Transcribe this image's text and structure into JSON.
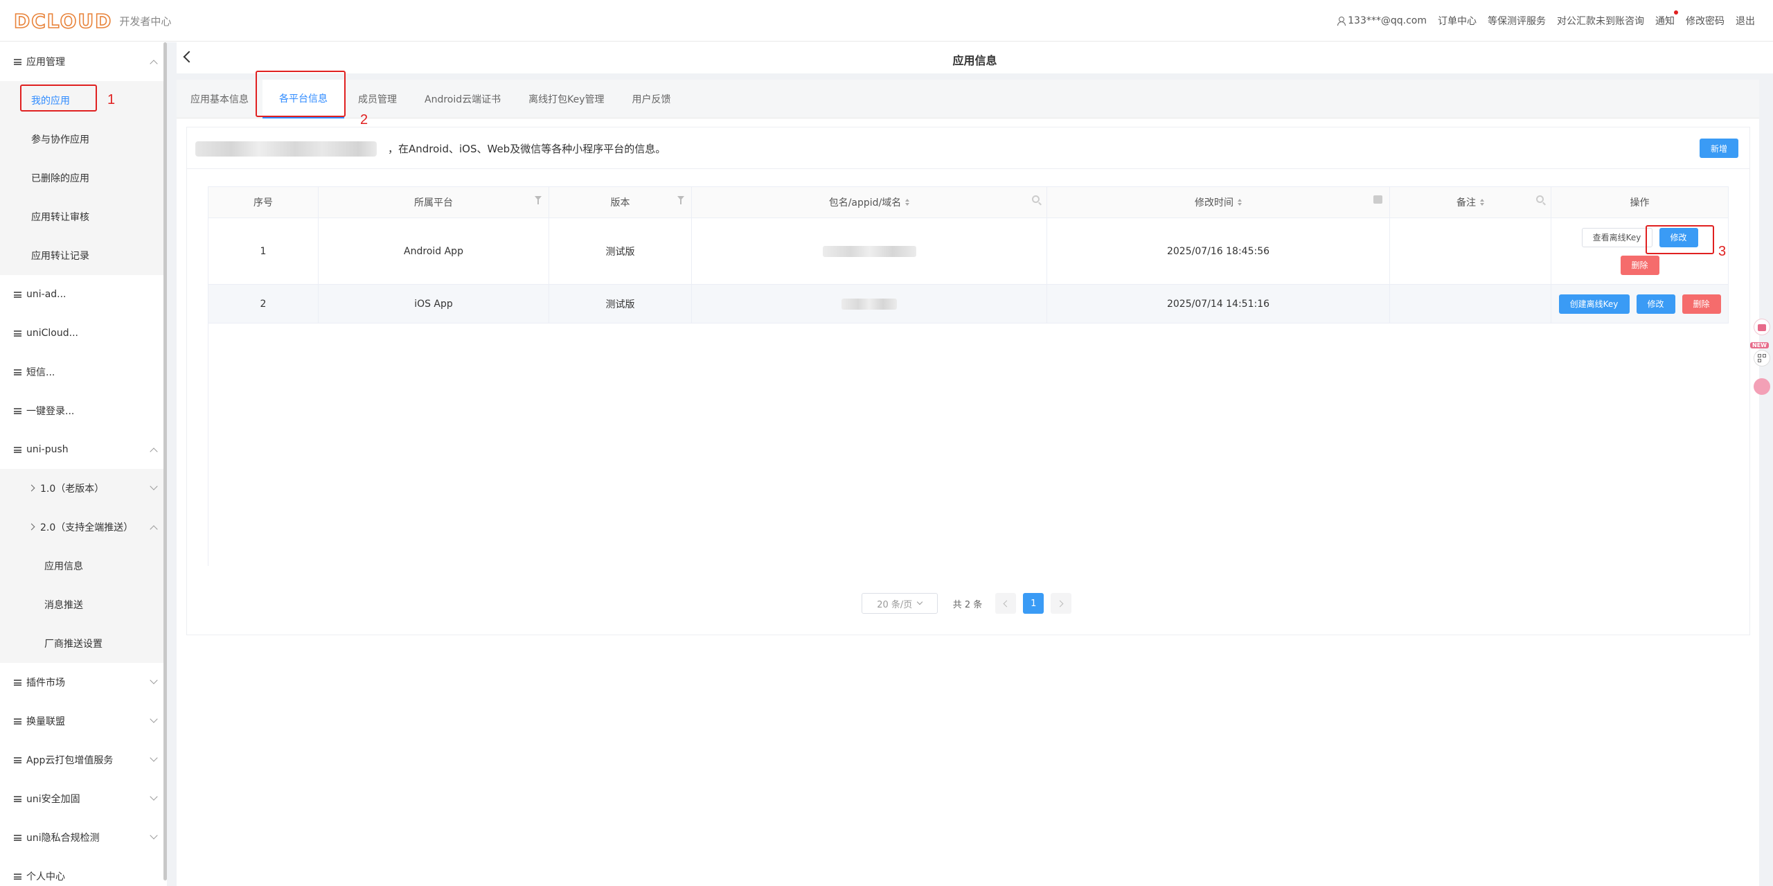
{
  "header": {
    "logo_text": "DCLOUD",
    "logo_sub": "开发者中心",
    "user": "133***@qq.com",
    "nav": [
      "订单中心",
      "等保测评服务",
      "对公汇款未到账咨询",
      "通知",
      "修改密码",
      "退出"
    ]
  },
  "sidebar": {
    "group_app": "应用管理",
    "my_apps": "我的应用",
    "collab_apps": "参与协作应用",
    "deleted_apps": "已删除的应用",
    "transfer_review": "应用转让审核",
    "transfer_records": "应用转让记录",
    "uni_ad": "uni-ad...",
    "unicloud": "uniCloud...",
    "sms": "短信...",
    "one_login": "一键登录...",
    "uni_push": "uni-push",
    "push_v1": "1.0（老版本）",
    "push_v2": "2.0（支持全端推送）",
    "app_info": "应用信息",
    "msg_push": "消息推送",
    "vendor_settings": "厂商推送设置",
    "plugin_market": "插件市场",
    "exchange": "换量联盟",
    "app_cloud_pkg": "App云打包增值服务",
    "uni_secure": "uni安全加固",
    "uni_privacy": "uni隐私合规检测",
    "personal": "个人中心"
  },
  "page": {
    "title": "应用信息",
    "tabs": [
      "应用基本信息",
      "各平台信息",
      "成员管理",
      "Android云端证书",
      "离线打包Key管理",
      "用户反馈"
    ],
    "active_tab": "各平台信息",
    "description": "，在Android、iOS、Web及微信等各种小程序平台的信息。",
    "new_button": "新增"
  },
  "table": {
    "headers": [
      "序号",
      "所属平台",
      "版本",
      "包名/appid/域名",
      "修改时间",
      "备注",
      "操作"
    ],
    "rows": [
      {
        "index": "1",
        "platform": "Android App",
        "version": "测试版",
        "modified": "2025/07/16 18:45:56",
        "note": "",
        "actions": [
          "查看离线Key",
          "修改",
          "删除"
        ]
      },
      {
        "index": "2",
        "platform": "iOS App",
        "version": "测试版",
        "modified": "2025/07/14 14:51:16",
        "note": "",
        "actions": [
          "创建离线Key",
          "修改",
          "删除"
        ]
      }
    ]
  },
  "pagination": {
    "page_size": "20 条/页",
    "total": "共 2 条",
    "current": "1"
  },
  "annotations": [
    "1",
    "2",
    "3"
  ],
  "float_badge": "NEW",
  "colors": {
    "accent": "#3a9bf5",
    "danger": "#f56c6c",
    "annotation": "#e02020"
  }
}
